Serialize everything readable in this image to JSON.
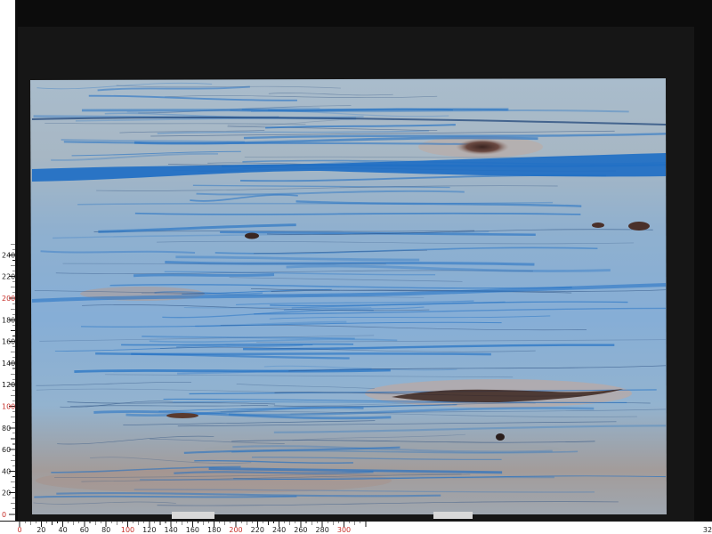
{
  "photo": {
    "subject": "blue-veined stone slab photographed against a black background with a measuring ruler along the left and bottom edges",
    "colors": {
      "backdrop": "#0c0c0c",
      "slab_base": "#9fb5c9",
      "vein_blue": "#1f6fc4",
      "vein_dark": "#2b4f80",
      "inclusion": "#5a3a2e"
    }
  },
  "ruler": {
    "x_labels": [
      "0",
      "20",
      "40",
      "60",
      "80",
      "100",
      "120",
      "140",
      "160",
      "180",
      "200",
      "220",
      "240",
      "260",
      "280",
      "300",
      "32"
    ],
    "x_red": [
      "0",
      "100",
      "200",
      "300"
    ],
    "y_labels": [
      "240",
      "220",
      "200",
      "180",
      "160",
      "140",
      "120",
      "100",
      "80",
      "60",
      "40",
      "20",
      "0"
    ],
    "y_red": [
      "200",
      "100",
      "0"
    ]
  }
}
